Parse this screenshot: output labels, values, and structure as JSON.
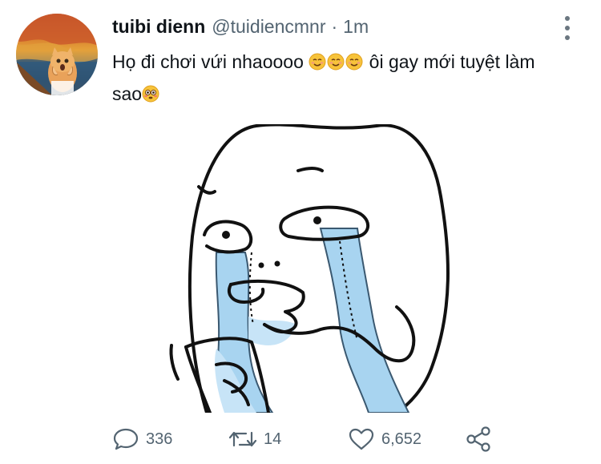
{
  "tweet": {
    "display_name": "tuibi dienn",
    "handle": "@tuidiencmnr",
    "separator": "·",
    "time": "1m",
    "text_part1": "Họ đi chơi vứi nhaoooo ",
    "text_part2": " ôi gay mới tuyệt làm sao",
    "emojis": [
      "smiling-face-emoji",
      "smiling-face-emoji",
      "smiling-face-emoji",
      "flushed-face-emoji"
    ]
  },
  "actions": {
    "reply_count": "336",
    "retweet_count": "14",
    "like_count": "6,652"
  },
  "icons": [
    "more-options-icon",
    "reply-icon",
    "retweet-icon",
    "like-icon",
    "share-icon"
  ],
  "colors": {
    "text": "#0f1419",
    "secondary": "#536471",
    "tear_blue": "#a8d4f0"
  }
}
